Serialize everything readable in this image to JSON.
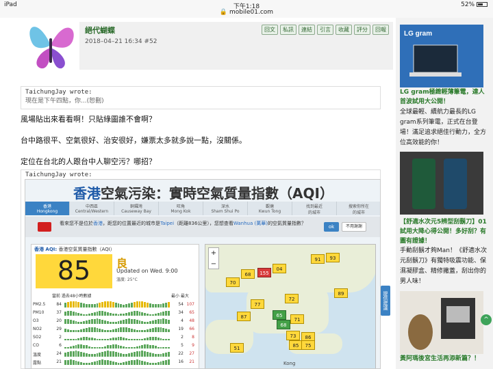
{
  "status": {
    "device": "iPad",
    "time": "下午1:18",
    "url": "mobile01.com",
    "battery": "52%"
  },
  "post": {
    "author": "絕代蝴蝶",
    "date": "2018–04–21 16:34",
    "number": "#52",
    "actions": [
      "回文",
      "私訊",
      "連結",
      "引言",
      "收藏",
      "評分",
      "回報"
    ]
  },
  "quote1": {
    "head": "TaichungJay wrote:",
    "body": "現在是下午四點，你...(恕刪)"
  },
  "paragraphs": [
    "風場貼出來看看啊！只貼綠圖誰不會啊？",
    "台中路很平、空氣很好、治安很好，嫌票太多就多說一點，沒關係。",
    "定位在台北的人跟台中人聊空污？哪招？"
  ],
  "quote2": {
    "head": "TaichungJay wrote:"
  },
  "aqi": {
    "title_prefix": "香港",
    "title_rest": "空氣污染：實時空氣質量指數（AQI）",
    "tabs": [
      {
        "zh": "香港",
        "en": "Hongkong"
      },
      {
        "zh": "中西區",
        "en": "Central/Western"
      },
      {
        "zh": "銅鑼灣",
        "en": "Causeway Bay"
      },
      {
        "zh": "旺角",
        "en": "Mong Kok"
      },
      {
        "zh": "深水",
        "en": "Sham Shui Po"
      },
      {
        "zh": "觀塘",
        "en": "Kwun Tong"
      },
      {
        "zh": "找到最近",
        "en": "的城市"
      },
      {
        "zh": "搜索你所在",
        "en": "的城市"
      }
    ],
    "alert_a": "看來您不是位於",
    "alert_place": "香港",
    "alert_b": "，距您的位置最近的城市是",
    "alert_city": "Taipei",
    "alert_c": "（距離836公里），您想查看",
    "alert_city2": "Wanhua (萬華)",
    "alert_d": "的空氣質量指數？",
    "ok": "ok",
    "no": "不用謝謝",
    "card_place": "香港 AQI:",
    "card_sub": "香港空氣質量指數（AQI）",
    "value": "85",
    "level": "良",
    "updated": "Updated on Wed. 9:00",
    "temp": "溫度: 25°C",
    "hist_head": "當前 過去48小時數據",
    "minmax": "最小 最大",
    "rows": [
      {
        "name": "PM2.5",
        "v": "84",
        "min": "54",
        "max": "107",
        "level": 0.75
      },
      {
        "name": "PM10",
        "v": "37",
        "min": "34",
        "max": "65",
        "level": 0.5
      },
      {
        "name": "O3",
        "v": "20",
        "min": "4",
        "max": "48",
        "level": 0.6
      },
      {
        "name": "NO2",
        "v": "29",
        "min": "19",
        "max": "66",
        "level": 0.55
      },
      {
        "name": "SO2",
        "v": "2",
        "min": "2",
        "max": "8",
        "level": 0.3
      },
      {
        "name": "CO",
        "v": "6",
        "min": "5",
        "max": "9",
        "level": 0.4
      },
      {
        "name": "溫度",
        "v": "24",
        "min": "22",
        "max": "27",
        "level": 0.7
      },
      {
        "name": "露點",
        "v": "21",
        "min": "16",
        "max": "21",
        "level": 0.6
      }
    ],
    "markers": [
      "70",
      "68",
      "155",
      "04",
      "91",
      "93",
      "77",
      "72",
      "89",
      "87",
      "65",
      "68",
      "71",
      "73",
      "86",
      "85",
      "75",
      "51"
    ],
    "map_word": "Kong",
    "side_tab": "提供建議"
  },
  "ads": [
    {
      "title": "LG gram極緻輕薄筆電，達人首波試用大公開！",
      "text": "全球最輕、續航力最長的LG gram系列筆電，正式在台登場！滿足追求絕佳行動力，全方位高效能的你！"
    },
    {
      "title": "【舒適水次元5辨型刮鬍刀】01試用大降心得公開！多好刮？有圖有證據！",
      "text": "手動刮鬍才夠Man！《舒適水次元刮鬍刀》有獨特吸震功能、保濕凝膠盒、精修撇蓋，刮出你的男人味！"
    },
    {
      "title": "黃阿瑪後宮生活再添新篇？！"
    }
  ]
}
